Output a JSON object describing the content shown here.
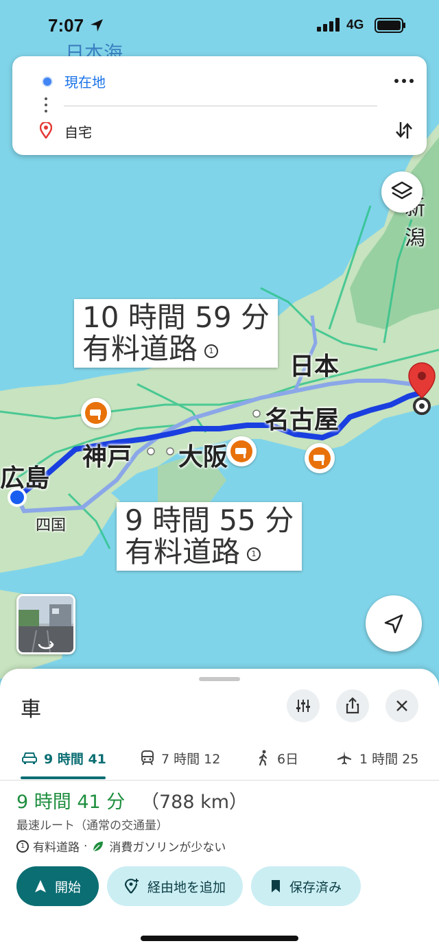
{
  "status_bar": {
    "time": "7:07",
    "network": "4G"
  },
  "search": {
    "origin": "現在地",
    "destination": "自宅"
  },
  "map": {
    "labels": {
      "sea": "日本海",
      "niigata": "新潟",
      "japan": "日本",
      "hiroshima": "広島",
      "kobe": "神戸",
      "osaka": "大阪",
      "nagoya": "名古屋",
      "shikoku": "四国"
    },
    "routes": [
      {
        "duration": "10 時間 59 分",
        "note": "有料道路"
      },
      {
        "duration": "9 時間 55 分",
        "note": "有料道路"
      }
    ],
    "toll_icon_text": "1"
  },
  "sheet": {
    "mode_title": "車",
    "tabs": [
      {
        "icon": "car-icon",
        "label": "9 時間 41"
      },
      {
        "icon": "train-icon",
        "label": "7 時間 12"
      },
      {
        "icon": "walk-icon",
        "label": "6日"
      },
      {
        "icon": "plane-icon",
        "label": "1 時間 25"
      }
    ],
    "duration": "9 時間 41 分",
    "distance": "（788 km）",
    "route_desc": "最速ルート（通常の交通量）",
    "tag_toll": "有料道路",
    "tag_sep": "·",
    "tag_eco": "消費ガソリンが少ない",
    "buttons": {
      "start": "開始",
      "add_stop": "経由地を追加",
      "saved": "保存済み"
    }
  },
  "colors": {
    "accent": "#0b6e73",
    "route_primary": "#1a3fe0",
    "route_alt": "#8fa8e8",
    "duration_green": "#1e8e3e",
    "camera_orange": "#e8710a"
  }
}
